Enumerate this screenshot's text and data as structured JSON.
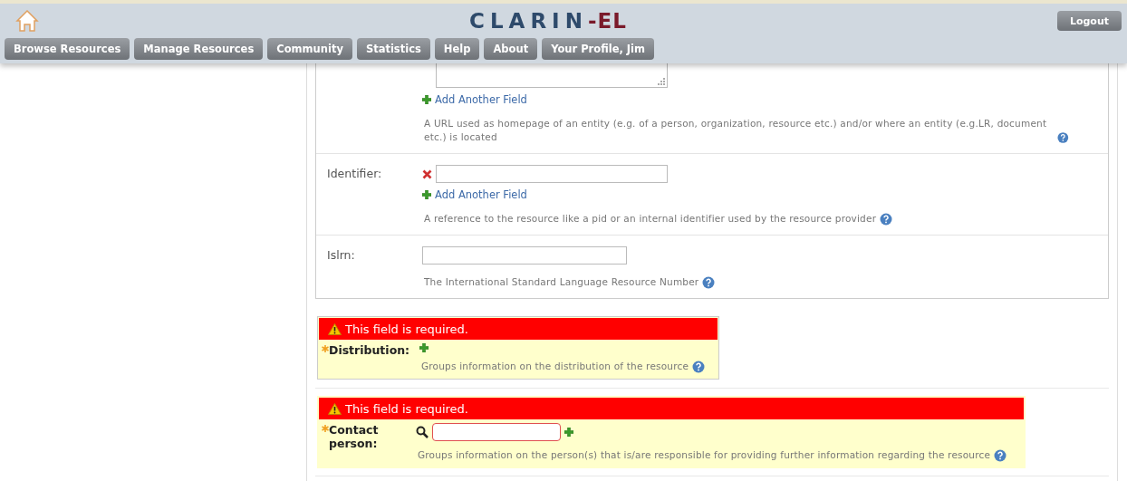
{
  "header": {
    "logo": {
      "main": "CLARIN",
      "suffix": "-EL"
    },
    "nav": [
      "Browse Resources",
      "Manage Resources",
      "Community",
      "Statistics",
      "Help",
      "About",
      "Your Profile, Jim"
    ],
    "logout": "Logout"
  },
  "fields": [
    {
      "kind": "textarea",
      "add_link": "Add Another Field",
      "help": "A URL used as homepage of an entity (e.g. of a person, organization, resource etc.) and/or where an entity (e.g.LR, document etc.) is located"
    },
    {
      "kind": "removable",
      "label": "Identifier:",
      "add_link": "Add Another Field",
      "help": "A reference to the resource like a pid or an internal identifier used by the resource provider"
    },
    {
      "kind": "single",
      "label": "Islrn:",
      "help": "The International Standard Language Resource Number"
    }
  ],
  "required_groups": [
    {
      "kind": "add",
      "error": "This field is required.",
      "label": "Distribution:",
      "help": "Groups information on the distribution of the resource"
    },
    {
      "kind": "lookup",
      "error": "This field is required.",
      "label": "Contact person:",
      "help": "Groups information on the person(s) that is/are responsible for providing further information regarding the resource"
    }
  ]
}
